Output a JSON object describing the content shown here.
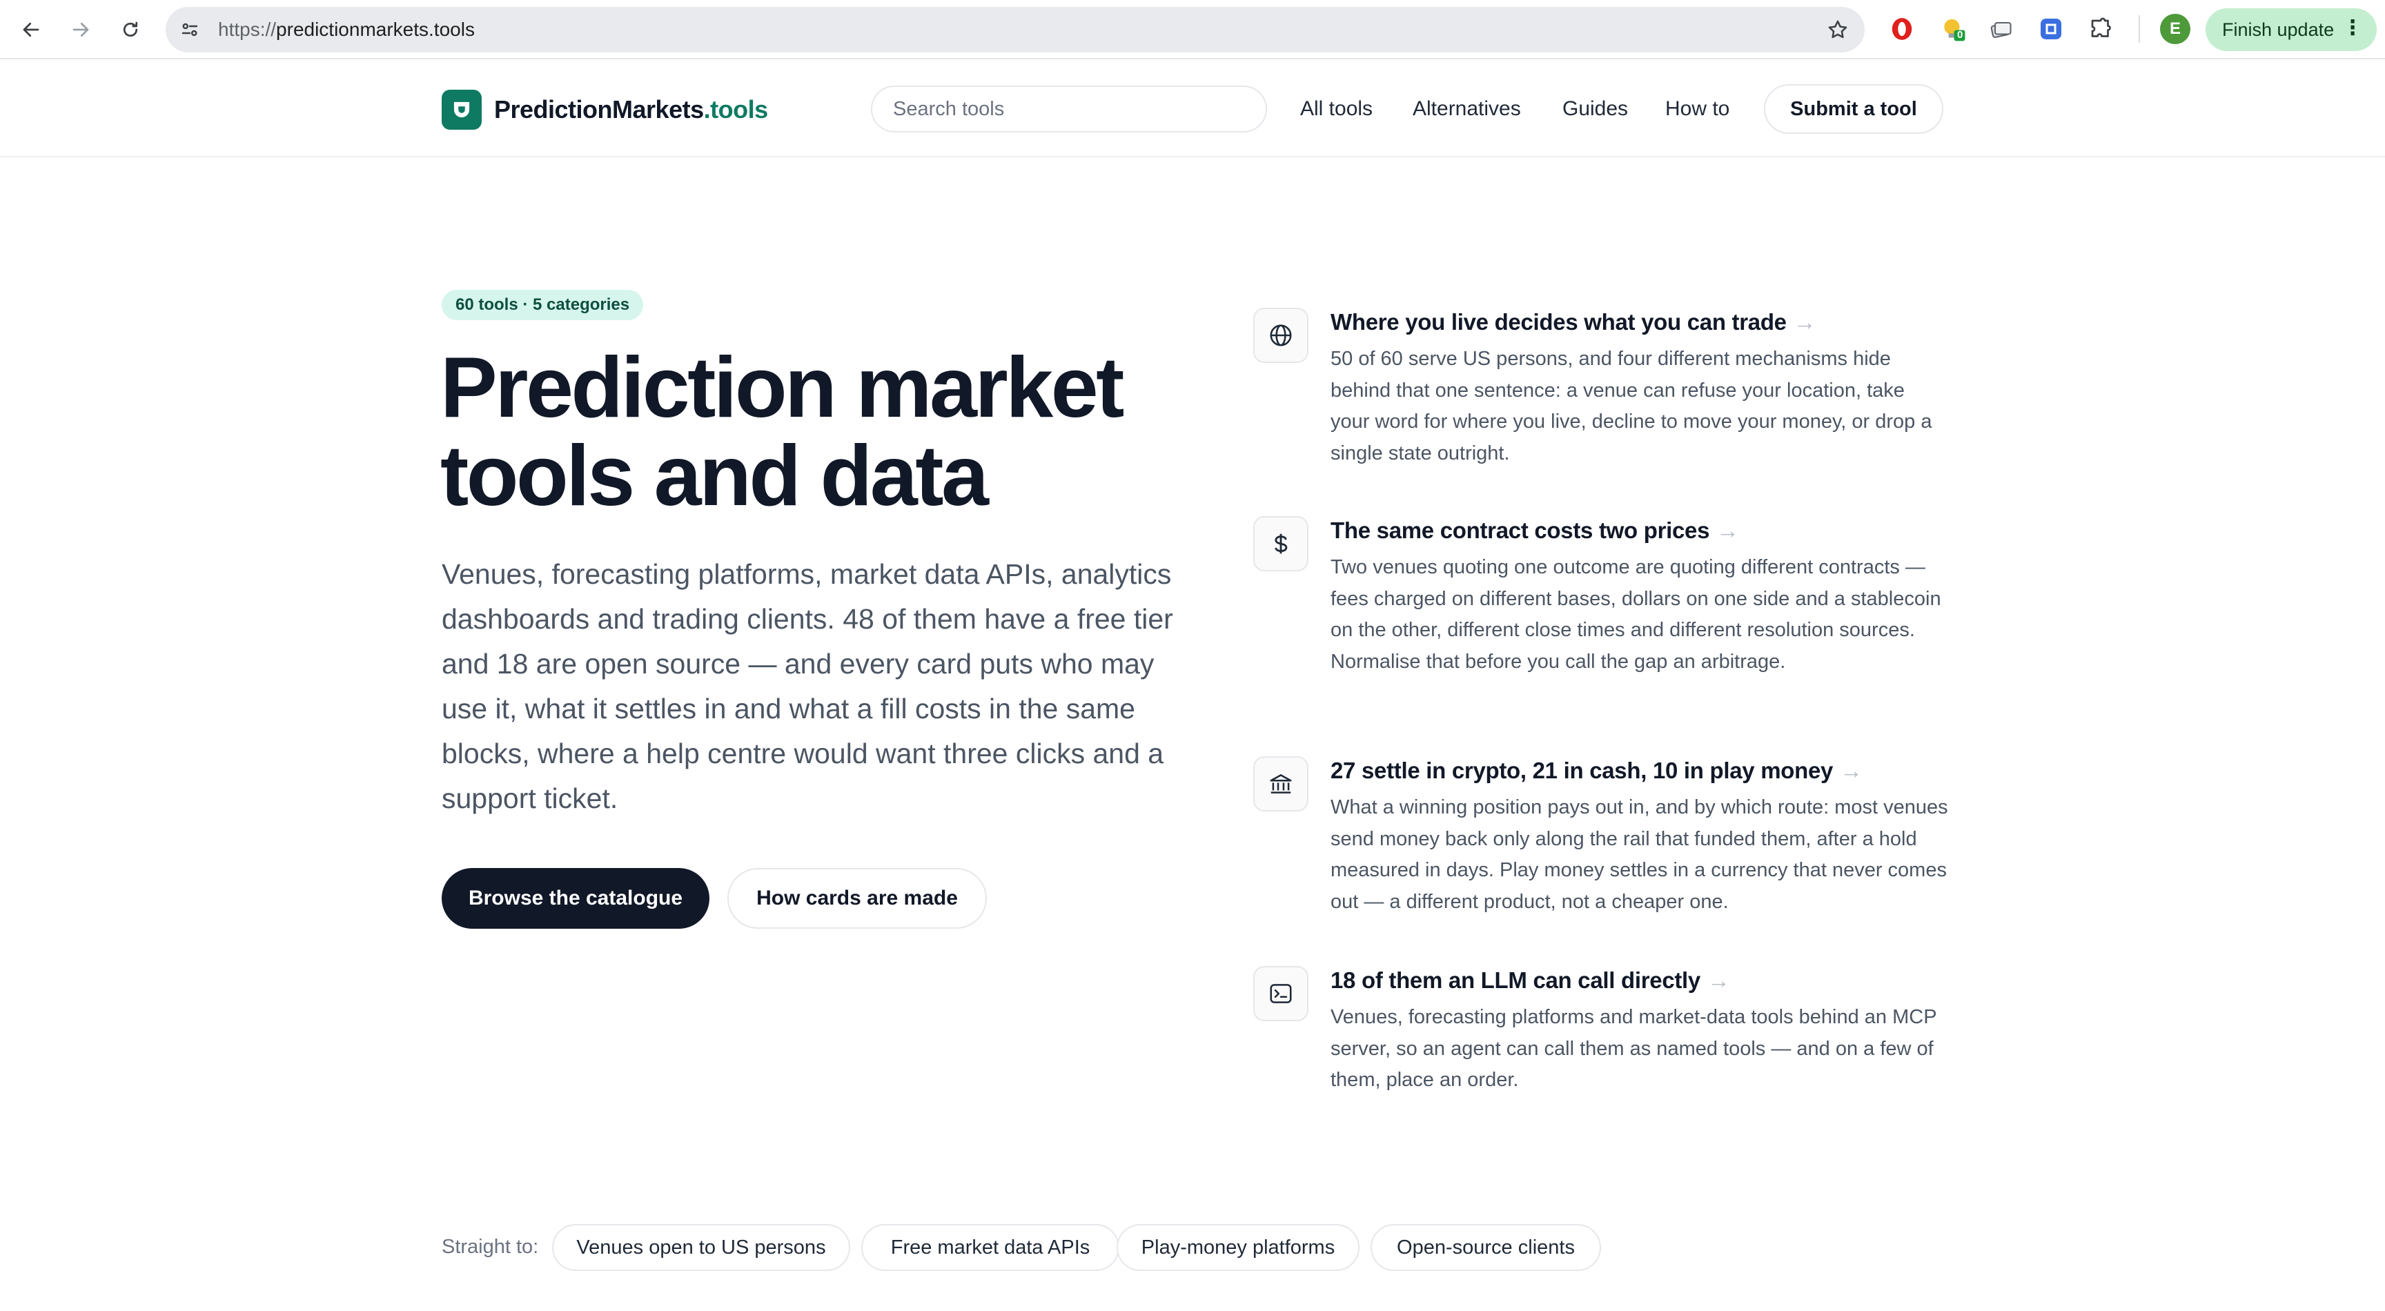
{
  "browser": {
    "url_scheme": "https://",
    "url_host": "predictionmarkets.tools",
    "extension_badge": "0",
    "profile_initial": "E",
    "finish_update_label": "Finish update",
    "menu_dots": "⋮"
  },
  "site": {
    "logo_name": "PredictionMarkets",
    "logo_tld": ".tools",
    "brand_color": "#0e7a62",
    "search_placeholder": "Search tools",
    "nav": [
      "All tools",
      "Alternatives",
      "Guides",
      "How to"
    ],
    "submit_label": "Submit a tool"
  },
  "hero": {
    "pill": "60 tools · 5 categories",
    "title_line1": "Prediction market",
    "title_line2": "tools and data",
    "description": "Venues, forecasting platforms, market data APIs, analytics dashboards and trading clients. 48 of them have a free tier and 18 are open source — and every card puts who may use it, what it settles in and what a fill costs in the same blocks, where a help centre would want three clicks and a support ticket.",
    "primary_cta": "Browse the catalogue",
    "secondary_cta": "How cards are made"
  },
  "features": [
    {
      "icon": "globe-icon",
      "title": "Where you live decides what you can trade",
      "arrow": "→",
      "body": "50 of 60 serve US persons, and four different mechanisms hide behind that one sentence: a venue can refuse your location, take your word for where you live, decline to move your money, or drop a single state outright."
    },
    {
      "icon": "dollar-icon",
      "title": "The same contract costs two prices",
      "arrow": "→",
      "body": "Two venues quoting one outcome are quoting different contracts — fees charged on different bases, dollars on one side and a stablecoin on the other, different close times and different resolution sources. Normalise that before you call the gap an arbitrage."
    },
    {
      "icon": "bank-icon",
      "title": "27 settle in crypto, 21 in cash, 10 in play money",
      "arrow": "→",
      "body": "What a winning position pays out in, and by which route: most venues send money back only along the rail that funded them, after a hold measured in days. Play money settles in a currency that never comes out — a different product, not a cheaper one."
    },
    {
      "icon": "terminal-icon",
      "title": "18 of them an LLM can call directly",
      "arrow": "→",
      "body": "Venues, forecasting platforms and market-data tools behind an MCP server, so an agent can call them as named tools — and on a few of them, place an order."
    }
  ],
  "straight_to": {
    "label": "Straight to:",
    "chips": [
      "Venues open to US persons",
      "Free market data APIs",
      "Play-money platforms",
      "Open-source clients"
    ]
  }
}
